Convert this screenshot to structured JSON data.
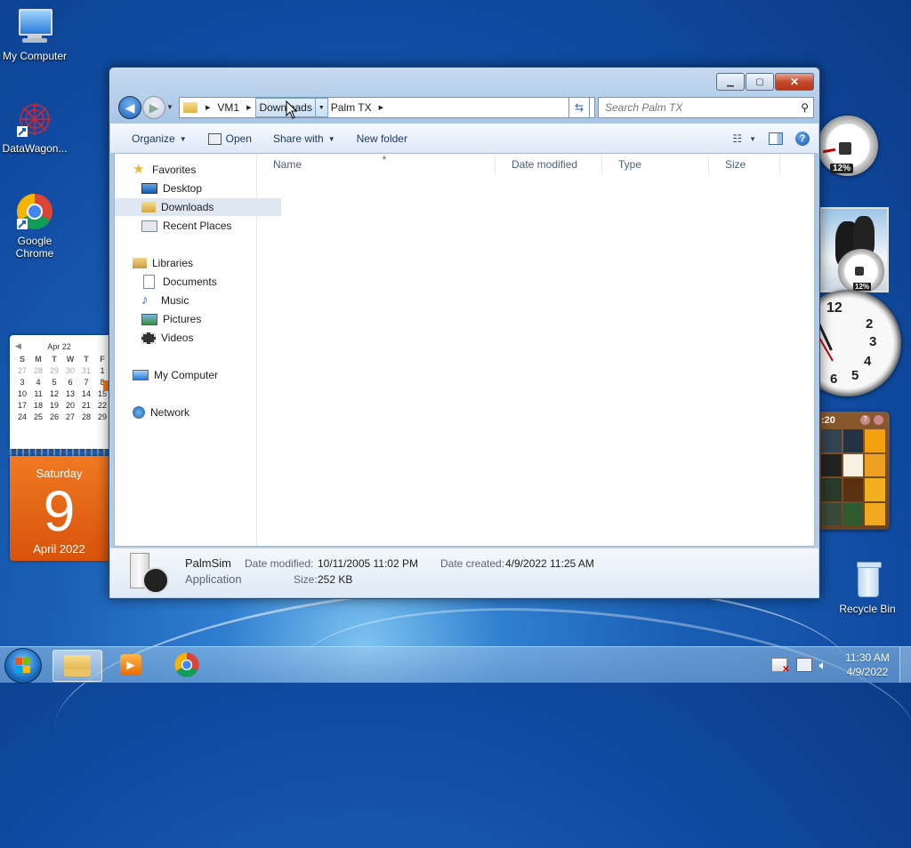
{
  "desktop": {
    "icons": [
      {
        "label": "My Computer"
      },
      {
        "label": "DataWagon..."
      },
      {
        "label": "Google Chrome"
      },
      {
        "label": "Recycle Bin"
      }
    ]
  },
  "calendar_gadget": {
    "month_label": "Apr 22",
    "weekday_headers": [
      "S",
      "M",
      "T",
      "W",
      "T",
      "F"
    ],
    "weeks": [
      [
        "27",
        "28",
        "29",
        "30",
        "31",
        "1"
      ],
      [
        "3",
        "4",
        "5",
        "6",
        "7",
        "8"
      ],
      [
        "10",
        "11",
        "12",
        "13",
        "14",
        "15"
      ],
      [
        "17",
        "18",
        "19",
        "20",
        "21",
        "22"
      ],
      [
        "24",
        "25",
        "26",
        "27",
        "28",
        "29"
      ]
    ],
    "day_of_week": "Saturday",
    "day_number": "9",
    "month_year": "April 2022"
  },
  "cpu_gadget": {
    "top_percent": "12%",
    "bottom_percent": "12%"
  },
  "clock_gadget": {
    "numbers": [
      "12",
      "1",
      "2",
      "3",
      "4",
      "5",
      "6"
    ]
  },
  "puzzle_gadget": {
    "timer": ":20"
  },
  "window": {
    "address": {
      "crumbs": [
        "VM1",
        "Downloads",
        "Palm TX"
      ],
      "selected_crumb": "Downloads"
    },
    "search": {
      "placeholder": "Search Palm TX"
    },
    "toolbar": {
      "organize": "Organize",
      "open": "Open",
      "share_with": "Share with",
      "new_folder": "New folder"
    },
    "nav": {
      "favorites": "Favorites",
      "desktop": "Desktop",
      "downloads": "Downloads",
      "recent_places": "Recent Places",
      "libraries": "Libraries",
      "documents": "Documents",
      "music": "Music",
      "pictures": "Pictures",
      "videos": "Videos",
      "my_computer": "My Computer",
      "network": "Network"
    },
    "columns": [
      "Name",
      "Date modified",
      "Type",
      "Size"
    ],
    "details": {
      "name": "PalmSim",
      "type": "Application",
      "date_modified_label": "Date modified:",
      "date_modified": "10/11/2005 11:02 PM",
      "date_created_label": "Date created:",
      "date_created": "4/9/2022 11:25 AM",
      "size_label": "Size:",
      "size": "252 KB"
    }
  },
  "taskbar": {
    "time": "11:30 AM",
    "date": "4/9/2022"
  }
}
